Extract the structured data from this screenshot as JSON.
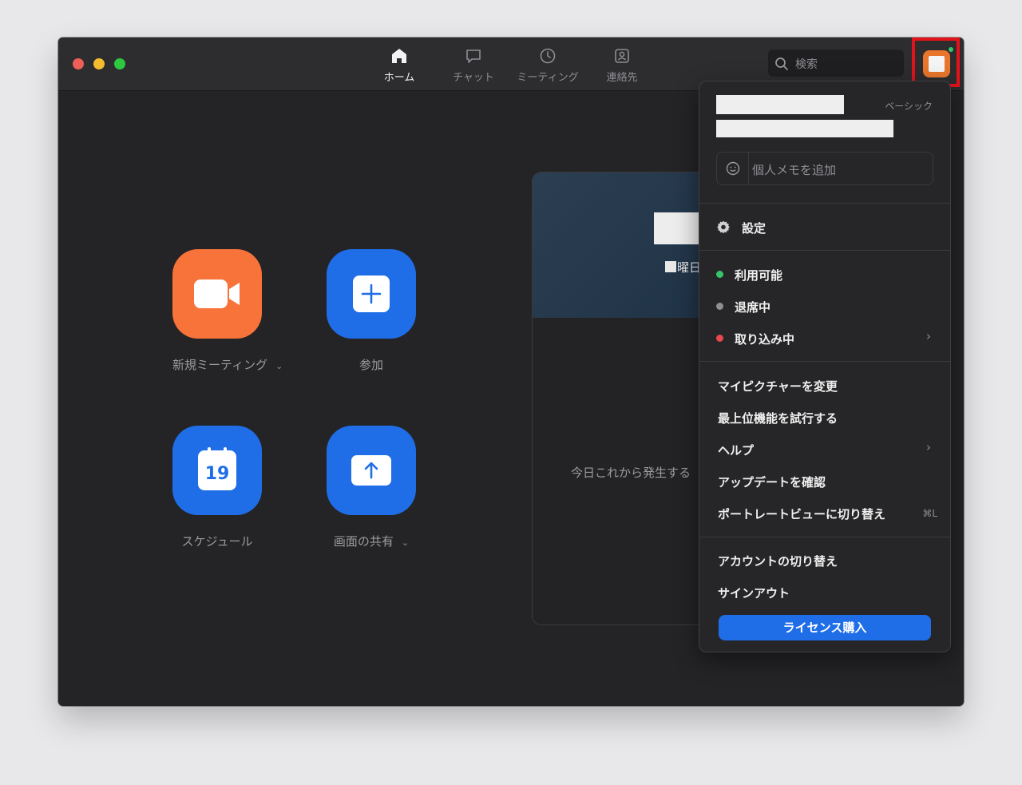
{
  "window": {
    "traffic_lights": [
      "close",
      "minimize",
      "maximize"
    ]
  },
  "nav": {
    "tabs": [
      {
        "label": "ホーム",
        "icon": "home-icon",
        "active": true
      },
      {
        "label": "チャット",
        "icon": "chat-icon",
        "active": false
      },
      {
        "label": "ミーティング",
        "icon": "clock-icon",
        "active": false
      },
      {
        "label": "連絡先",
        "icon": "contacts-icon",
        "active": false
      }
    ]
  },
  "search": {
    "placeholder": "検索"
  },
  "avatar": {
    "status_color": "#35c46a",
    "highlight_color": "#e3131b"
  },
  "actions": [
    {
      "label": "新規ミーティング",
      "icon": "video-camera-icon",
      "color": "#f7733a",
      "has_dropdown": true
    },
    {
      "label": "参加",
      "icon": "plus-icon",
      "color": "#1f6ee8",
      "has_dropdown": false
    },
    {
      "label": "スケジュール",
      "icon": "calendar-icon",
      "calendar_day": "19",
      "color": "#1f6ee8",
      "has_dropdown": false
    },
    {
      "label": "画面の共有",
      "icon": "share-screen-icon",
      "color": "#1f6ee8",
      "has_dropdown": true
    }
  ],
  "meeting_panel": {
    "day_label": "曜日",
    "empty_text": "今日これから発生する"
  },
  "dropdown": {
    "plan": "ベーシック",
    "memo_placeholder": "個人メモを追加",
    "settings": "設定",
    "statuses": [
      {
        "label": "利用可能",
        "color": "#35c46a"
      },
      {
        "label": "退席中",
        "color": "#8e8e93"
      },
      {
        "label": "取り込み中",
        "color": "#e5484d"
      }
    ],
    "items_group1": [
      "マイピクチャーを変更",
      "最上位機能を試行する",
      "ヘルプ",
      "アップデートを確認",
      "ポートレートビューに切り替え"
    ],
    "portrait_shortcut": "⌘L",
    "items_group2": [
      "アカウントの切り替え",
      "サインアウト"
    ],
    "license_button": "ライセンス購入"
  }
}
